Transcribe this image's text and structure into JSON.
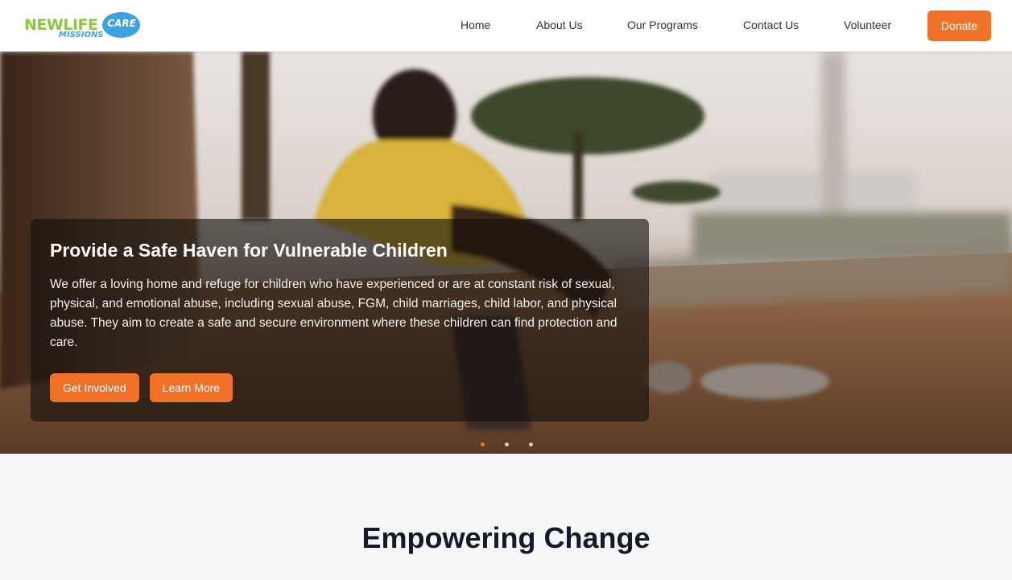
{
  "logo": {
    "new_life": "NEWLIFE",
    "care": "CARE",
    "missions": "MISSIONS"
  },
  "nav": {
    "items": [
      "Home",
      "About Us",
      "Our Programs",
      "Contact Us",
      "Volunteer"
    ],
    "donate_label": "Donate"
  },
  "hero": {
    "title": "Provide a Safe Haven for Vulnerable Children",
    "text": "We offer a loving home and refuge for children who have experienced or are at constant risk of sexual, physical, and emotional abuse, including sexual abuse, FGM, child marriages, child labor, and physical abuse. They aim to create a safe and secure environment where these children can find protection and care.",
    "primary_button": "Get Involved",
    "secondary_button": "Learn More",
    "slides_count": 3,
    "active_slide": 1
  },
  "section": {
    "title": "Empowering Change"
  },
  "colors": {
    "accent": "#f07127",
    "logo_green": "#8dc63f",
    "logo_blue": "#3ba3e0",
    "heading": "#151a2b"
  }
}
